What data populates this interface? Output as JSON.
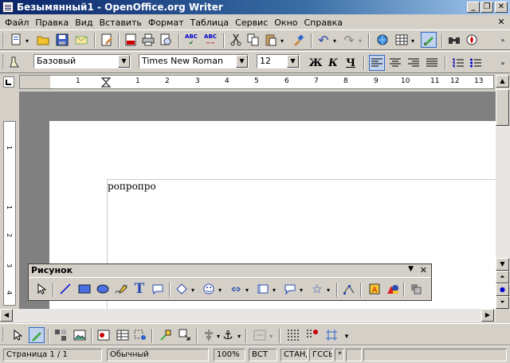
{
  "window": {
    "title": "Безымянный1 - OpenOffice.org Writer",
    "minimize": "_",
    "restore": "❐",
    "close": "✕"
  },
  "menu": [
    "Файл",
    "Правка",
    "Вид",
    "Вставить",
    "Формат",
    "Таблица",
    "Сервис",
    "Окно",
    "Справка"
  ],
  "menu_close": "✕",
  "format": {
    "style": "Базовый",
    "font": "Times New Roman",
    "size": "12",
    "bold": "Ж",
    "italic": "К",
    "underline": "Ч"
  },
  "ruler": {
    "marks": [
      "1",
      "1",
      "2",
      "3",
      "4",
      "5",
      "6",
      "7",
      "8",
      "9",
      "10",
      "11",
      "12",
      "13"
    ]
  },
  "vruler": {
    "marks": [
      "1",
      "1",
      "2",
      "3",
      "4"
    ]
  },
  "document": {
    "text": "ропропро"
  },
  "drawing_toolbar": {
    "title": "Рисунок",
    "menu": "▼",
    "close": "✕"
  },
  "status": {
    "page": "Страница  1 / 1",
    "style": "Обычный",
    "zoom": "100%",
    "insert": "ВСТ",
    "select": "СТАНД",
    "hyper": "ГССЫЛ",
    "modified": "*"
  }
}
